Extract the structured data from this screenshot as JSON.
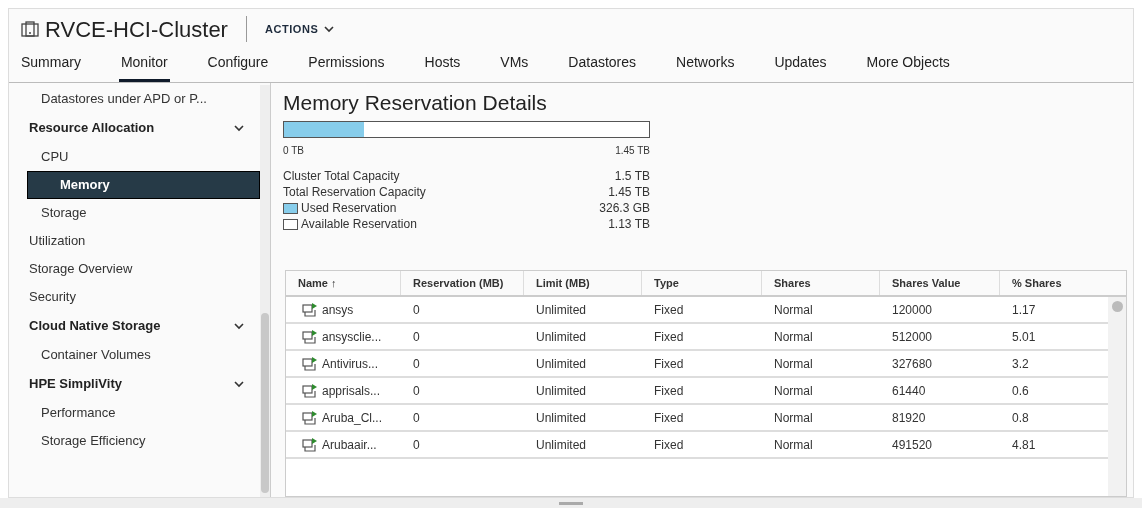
{
  "header": {
    "title": "RVCE-HCI-Cluster",
    "actions": "ACTIONS"
  },
  "tabs": [
    {
      "label": "Summary",
      "selected": false
    },
    {
      "label": "Monitor",
      "selected": true
    },
    {
      "label": "Configure",
      "selected": false
    },
    {
      "label": "Permissions",
      "selected": false
    },
    {
      "label": "Hosts",
      "selected": false
    },
    {
      "label": "VMs",
      "selected": false
    },
    {
      "label": "Datastores",
      "selected": false
    },
    {
      "label": "Networks",
      "selected": false
    },
    {
      "label": "Updates",
      "selected": false
    },
    {
      "label": "More Objects",
      "selected": false
    }
  ],
  "sidebar": {
    "partial_group_children": [
      {
        "label": "Datastores under APD or P...",
        "selected": false
      }
    ],
    "items": [
      {
        "kind": "group",
        "label": "Resource Allocation",
        "expanded": true,
        "children": [
          {
            "label": "CPU",
            "selected": false
          },
          {
            "label": "Memory",
            "selected": true
          },
          {
            "label": "Storage",
            "selected": false
          }
        ]
      },
      {
        "kind": "item",
        "label": "Utilization",
        "selected": false
      },
      {
        "kind": "item",
        "label": "Storage Overview",
        "selected": false
      },
      {
        "kind": "item",
        "label": "Security",
        "selected": false
      },
      {
        "kind": "group",
        "label": "Cloud Native Storage",
        "expanded": true,
        "children": [
          {
            "label": "Container Volumes",
            "selected": false
          }
        ]
      },
      {
        "kind": "group",
        "label": "HPE SimpliVity",
        "expanded": true,
        "children": [
          {
            "label": "Performance",
            "selected": false
          },
          {
            "label": "Storage Efficiency",
            "selected": false
          }
        ]
      }
    ]
  },
  "details": {
    "title": "Memory Reservation Details",
    "bar": {
      "level": 0.22,
      "min": "0 TB",
      "max": "1.45 TB"
    },
    "stats": [
      {
        "kind": "plain",
        "label": "Cluster Total Capacity",
        "value": "1.5 TB"
      },
      {
        "kind": "plain",
        "label": "Total Reservation Capacity",
        "value": "1.45 TB"
      },
      {
        "kind": "used",
        "label": "Used Reservation",
        "value": "326.3 GB"
      },
      {
        "kind": "available",
        "label": "Available Reservation",
        "value": "1.13 TB"
      }
    ]
  },
  "table": {
    "columns": [
      "Name ↑",
      "Reservation (MB)",
      "Limit (MB)",
      "Type",
      "Shares",
      "Shares Value",
      "% Shares"
    ],
    "rows": [
      [
        "ansys",
        "0",
        "Unlimited",
        "Fixed",
        "Normal",
        "120000",
        "1.17"
      ],
      [
        "ansysclie...",
        "0",
        "Unlimited",
        "Fixed",
        "Normal",
        "512000",
        "5.01"
      ],
      [
        "Antivirus...",
        "0",
        "Unlimited",
        "Fixed",
        "Normal",
        "327680",
        "3.2"
      ],
      [
        "apprisals...",
        "0",
        "Unlimited",
        "Fixed",
        "Normal",
        "61440",
        "0.6"
      ],
      [
        "Aruba_Cl...",
        "0",
        "Unlimited",
        "Fixed",
        "Normal",
        "81920",
        "0.8"
      ],
      [
        "Arubaair...",
        "0",
        "Unlimited",
        "Fixed",
        "Normal",
        "491520",
        "4.81"
      ]
    ]
  }
}
